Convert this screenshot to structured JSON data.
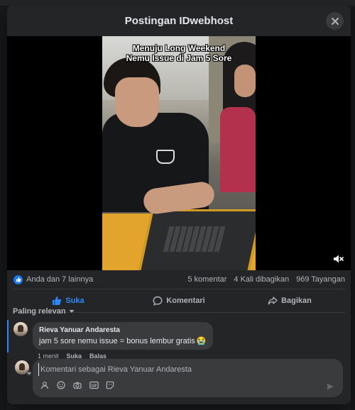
{
  "modal": {
    "title": "Postingan IDwebhost",
    "close_label": "Tutup"
  },
  "video": {
    "caption_line1": "Menuju Long Weekend",
    "caption_line2": "Nemu Issue di Jam 5 Sore",
    "muted": true
  },
  "stats": {
    "reactions": "Anda dan 7 lainnya",
    "comments": "5 komentar",
    "shares": "4 Kali dibagikan",
    "views": "969 Tayangan"
  },
  "actions": {
    "like": "Suka",
    "comment": "Komentari",
    "share": "Bagikan"
  },
  "comments": {
    "sort_label": "Paling relevan",
    "items": [
      {
        "author": "Rieva Yanuar Andaresta",
        "text": "jam 5 sore nemu issue = bonus lembur gratis",
        "emoji": "😭",
        "time": "1 menit",
        "like": "Suka",
        "reply": "Balas"
      }
    ]
  },
  "composer": {
    "placeholder": "Komentari sebagai Rieva Yanuar Andaresta",
    "value": ""
  },
  "colors": {
    "accent": "#2d88ff",
    "surface": "#242526",
    "bubble": "#3a3b3c"
  }
}
